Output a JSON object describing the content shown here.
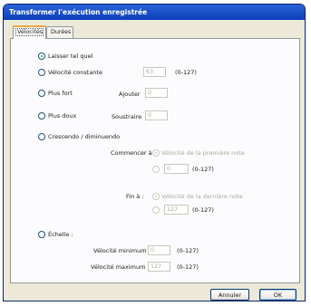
{
  "window": {
    "title": "Transformer l'exécution enregistrée"
  },
  "tabs": [
    {
      "label": "Vélocités"
    },
    {
      "label": "Durées"
    }
  ],
  "options": {
    "keep": {
      "label": "Laisser tel quel",
      "checked": true
    },
    "constant": {
      "label": "Vélocité constante",
      "value": "63",
      "range": "(0-127)"
    },
    "louder": {
      "label": "Plus fort",
      "add_label": "Ajouter",
      "value": "0"
    },
    "softer": {
      "label": "Plus doux",
      "subtract_label": "Soustraire",
      "value": "0"
    },
    "crescendo": {
      "label": "Crescendo / diminuendo",
      "start_label": "Commencer à :",
      "start_option": "Vélocité de la première note",
      "start_value": "0",
      "start_range": "(0-127)",
      "end_label": "Fin à :",
      "end_option": "Vélocité de la dernière note",
      "end_value": "127",
      "end_range": "(0-127)"
    },
    "scale": {
      "label": "Échelle :",
      "min_label": "Vélocité minimum",
      "min_value": "0",
      "min_range": "(0-127)",
      "max_label": "Vélocité maximum",
      "max_value": "127",
      "max_range": "(0-127)"
    }
  },
  "buttons": {
    "cancel": "Annuler",
    "ok": "OK"
  }
}
